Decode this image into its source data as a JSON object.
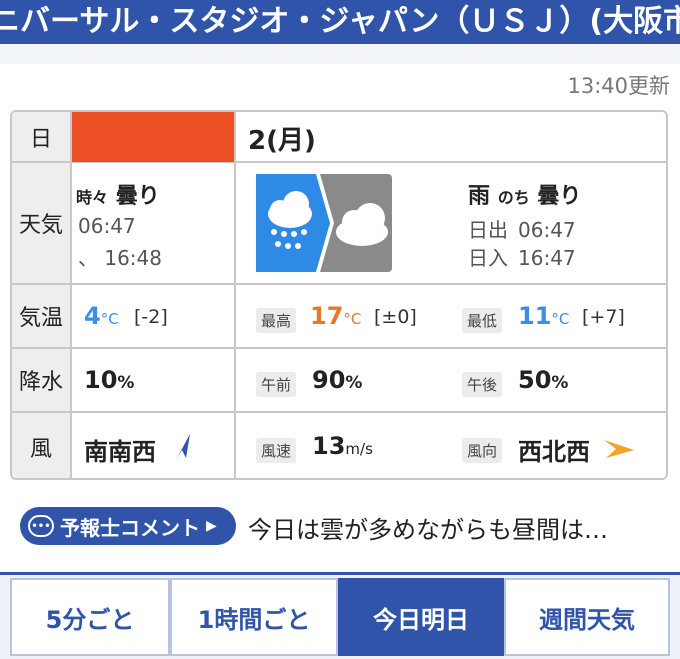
{
  "header": {
    "title": "ニバーサル・スタジオ・ジャパン（ＵＳＪ）(大阪市"
  },
  "updated": "13:40更新",
  "table": {
    "row_labels": {
      "day": "日",
      "weather": "天気",
      "temp": "気温",
      "precip": "降水",
      "wind": "風"
    },
    "day_label": "2(月)",
    "left": {
      "weather_prefix": "時々",
      "weather_main": "曇り",
      "sunrise": "06:47",
      "sunset": "16:48",
      "sunset_label_partial": "、",
      "temp_value": "4",
      "temp_unit": "°C",
      "temp_diff": "[-2]",
      "precip_value": "10",
      "precip_unit": "%",
      "wind_dir": "南南西"
    },
    "right": {
      "weather_main1": "雨",
      "weather_connector": "のち",
      "weather_main2": "曇り",
      "sunrise_label": "日出",
      "sunrise": "06:47",
      "sunset_label": "日入",
      "sunset": "16:47",
      "high_label": "最高",
      "high_value": "17",
      "high_unit": "°C",
      "high_diff": "[±0]",
      "low_label": "最低",
      "low_value": "11",
      "low_unit": "°C",
      "low_diff": "[+7]",
      "am_label": "午前",
      "am_value": "90",
      "pm_label": "午後",
      "pm_value": "50",
      "precip_unit": "%",
      "wind_speed_label": "風速",
      "wind_speed": "13",
      "wind_speed_unit": "m/s",
      "wind_dir_label": "風向",
      "wind_dir": "西北西"
    },
    "colors": {
      "high": "#e8772a",
      "low": "#3c8ee0",
      "day_bar": "#ec4f24",
      "arrow": "#f2a52b",
      "arrow_left": "#2f54a9"
    }
  },
  "comment": {
    "button_label": "予報士コメント",
    "text": "今日は雲が多めながらも昼間は…"
  },
  "tabs": [
    {
      "label": "5分ごと",
      "active": false
    },
    {
      "label": "1時間ごと",
      "active": false
    },
    {
      "label": "今日明日",
      "active": true
    },
    {
      "label": "週間天気",
      "active": false
    }
  ]
}
